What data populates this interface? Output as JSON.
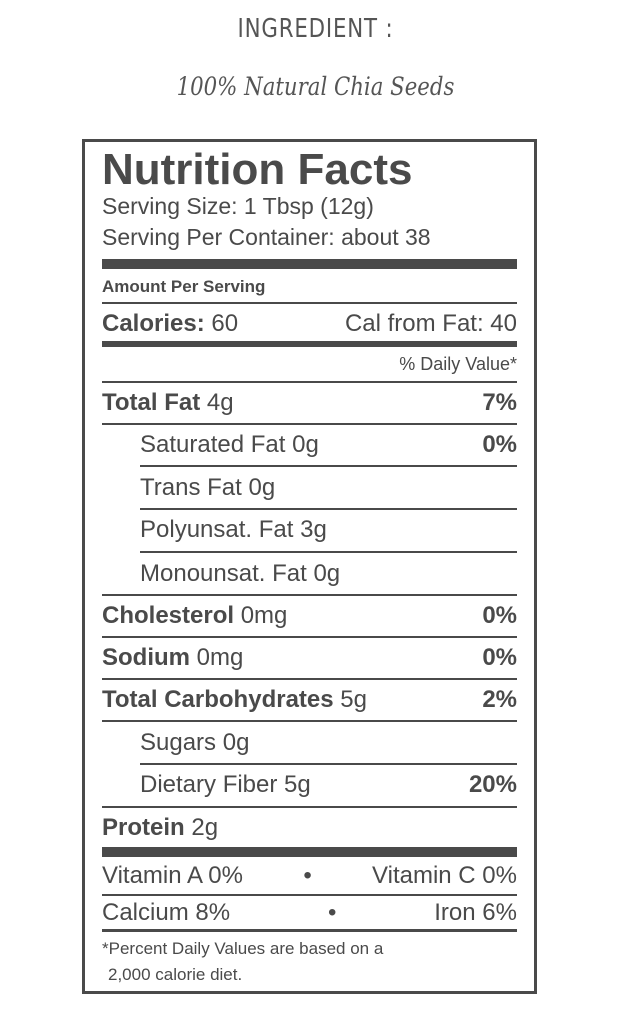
{
  "ingredient_heading": "INGREDIENT :",
  "ingredient_text": "100% Natural Chia Seeds",
  "label": {
    "title": "Nutrition Facts",
    "serving_size": "Serving Size: 1 Tbsp (12g)",
    "servings_per_container": "Serving Per Container: about 38",
    "amount_per_serving": "Amount Per Serving",
    "calories_label": "Calories:",
    "calories_value": "60",
    "cal_from_fat": "Cal from Fat: 40",
    "daily_value_header": "% Daily Value*",
    "nutrients": [
      {
        "name": "Total Fat",
        "amount": "4g",
        "dv": "7%"
      },
      {
        "name": "Saturated Fat",
        "amount": "0g",
        "dv": "0%"
      },
      {
        "name": "Trans Fat",
        "amount": "0g",
        "dv": ""
      },
      {
        "name": "Polyunsat. Fat",
        "amount": "3g",
        "dv": ""
      },
      {
        "name": "Monounsat. Fat",
        "amount": "0g",
        "dv": ""
      },
      {
        "name": "Cholesterol",
        "amount": "0mg",
        "dv": "0%"
      },
      {
        "name": "Sodium",
        "amount": "0mg",
        "dv": "0%"
      },
      {
        "name": "Total Carbohydrates",
        "amount": "5g",
        "dv": "2%"
      },
      {
        "name": "Sugars",
        "amount": "0g",
        "dv": ""
      },
      {
        "name": "Dietary Fiber",
        "amount": "5g",
        "dv": "20%"
      },
      {
        "name": "Protein",
        "amount": "2g",
        "dv": ""
      }
    ],
    "vitamins": [
      {
        "left": "Vitamin A 0%",
        "sep": "•",
        "right": "Vitamin C 0%"
      },
      {
        "left": "Calcium 8%",
        "sep": "•",
        "right": "Iron 6%"
      }
    ],
    "footnote_line1": "*Percent Daily Values are based on a",
    "footnote_line2": "2,000 calorie diet."
  }
}
